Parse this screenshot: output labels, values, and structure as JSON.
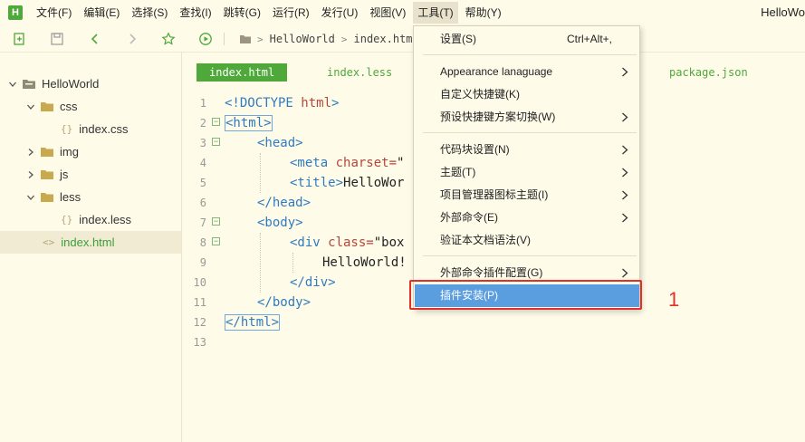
{
  "app": {
    "logo_letter": "H",
    "window_title": "HelloWo"
  },
  "menubar": {
    "items": [
      "文件(F)",
      "编辑(E)",
      "选择(S)",
      "查找(I)",
      "跳转(G)",
      "运行(R)",
      "发行(U)",
      "视图(V)",
      "工具(T)",
      "帮助(Y)"
    ],
    "active": "工具(T)"
  },
  "toolbar": {
    "breadcrumb": [
      "HelloWorld",
      "index.html"
    ]
  },
  "sidebar": {
    "tree": [
      {
        "label": "HelloWorld",
        "type": "folder",
        "expanded": true
      },
      {
        "label": "css",
        "type": "folder",
        "expanded": true
      },
      {
        "label": "index.css",
        "type": "file"
      },
      {
        "label": "img",
        "type": "folder",
        "expanded": false
      },
      {
        "label": "js",
        "type": "folder",
        "expanded": false
      },
      {
        "label": "less",
        "type": "folder",
        "expanded": true
      },
      {
        "label": "index.less",
        "type": "file"
      },
      {
        "label": "index.html",
        "type": "file",
        "selected": true
      }
    ]
  },
  "editor": {
    "tabs": [
      "index.html",
      "index.less",
      "package.json"
    ],
    "active_tab": "index.html",
    "line_numbers": [
      "1",
      "2",
      "3",
      "4",
      "5",
      "6",
      "7",
      "8",
      "9",
      "10",
      "11",
      "12",
      "13"
    ],
    "code": {
      "l1_a": "<!DOCTYPE",
      "l1_b": " html",
      "l1_c": ">",
      "l2": "<html>",
      "l3": "<head>",
      "l4_tag": "<meta",
      "l4_attr": " charset=",
      "l4_val": "\"",
      "l5_tag": "<title>",
      "l5_txt": "HelloWor",
      "l6": "</head>",
      "l7": "<body>",
      "l8_tag": "<div",
      "l8_attr": " class=",
      "l8_val": "\"box",
      "l9": "HelloWorld!",
      "l10": "</div>",
      "l11": "</body>",
      "l12": "</html>"
    }
  },
  "dropdown": {
    "items": [
      {
        "label": "设置(S)",
        "shortcut": "Ctrl+Alt+,",
        "submenu": false
      },
      {
        "label": "Appearance lanaguage",
        "shortcut": "",
        "submenu": true
      },
      {
        "label": "自定义快捷键(K)",
        "shortcut": "",
        "submenu": false
      },
      {
        "label": "预设快捷键方案切换(W)",
        "shortcut": "",
        "submenu": true
      },
      {
        "label": "代码块设置(N)",
        "shortcut": "",
        "submenu": true
      },
      {
        "label": "主题(T)",
        "shortcut": "",
        "submenu": true
      },
      {
        "label": "项目管理器图标主题(I)",
        "shortcut": "",
        "submenu": true
      },
      {
        "label": "外部命令(E)",
        "shortcut": "",
        "submenu": true
      },
      {
        "label": "验证本文档语法(V)",
        "shortcut": "",
        "submenu": false
      },
      {
        "label": "外部命令插件配置(G)",
        "shortcut": "",
        "submenu": true
      },
      {
        "label": "插件安装(P)",
        "shortcut": "",
        "submenu": false,
        "highlighted": true
      }
    ]
  },
  "annotation": {
    "number": "1",
    "color": "#e0302a"
  },
  "colors": {
    "accent": "#4ea83a",
    "highlight": "#5b9ee0",
    "background": "#fffbe9"
  }
}
